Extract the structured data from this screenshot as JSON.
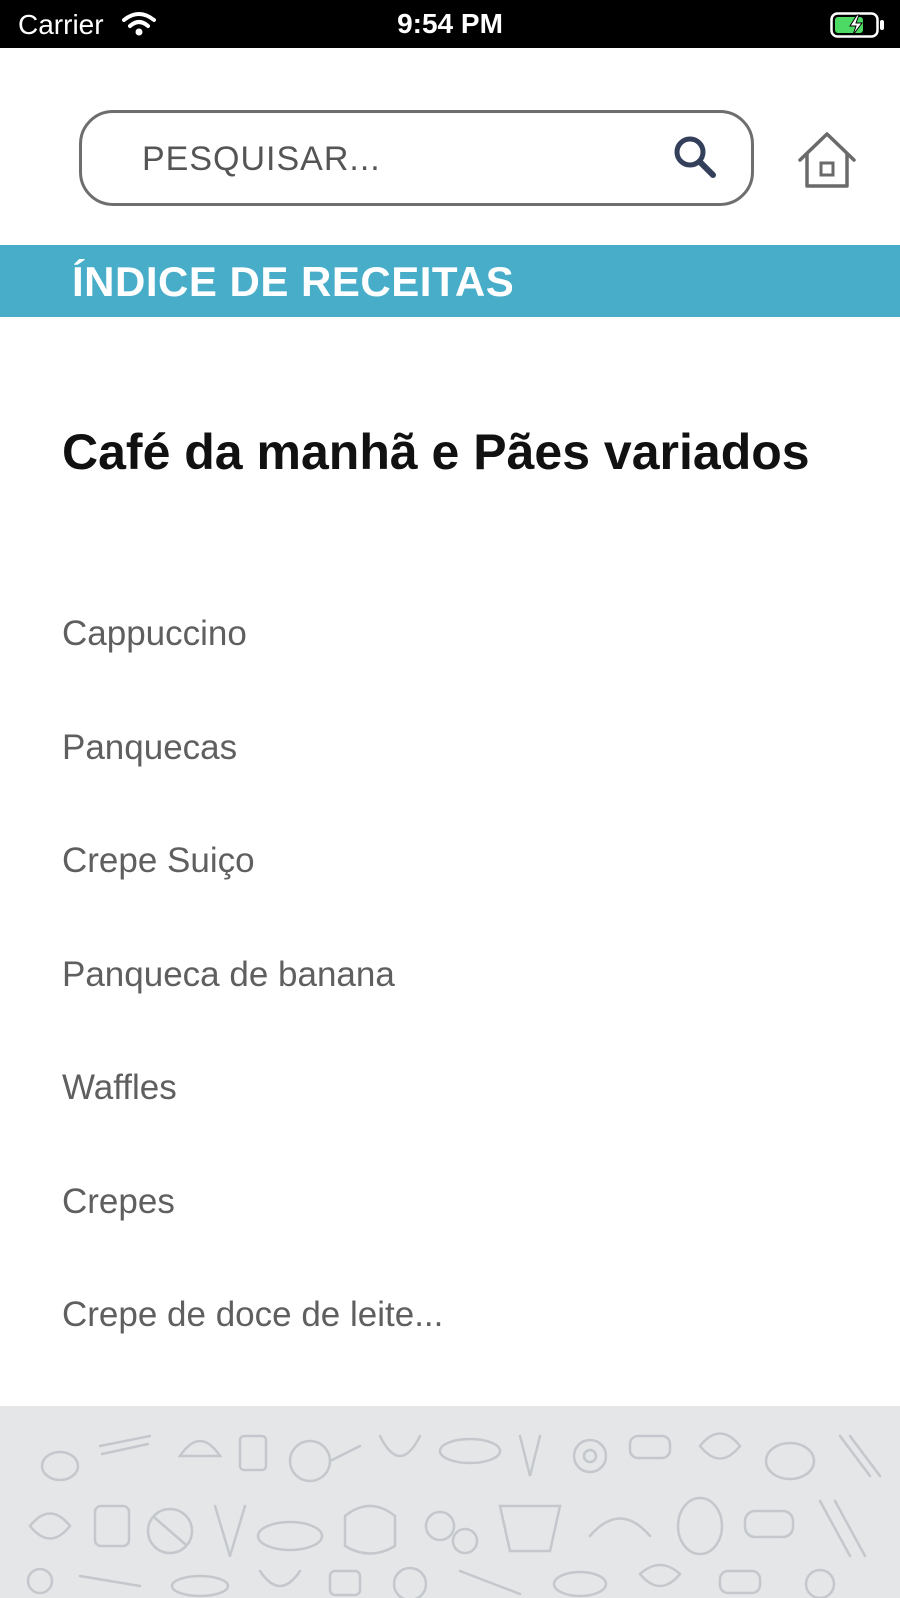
{
  "status_bar": {
    "carrier": "Carrier",
    "time": "9:54 PM",
    "wifi_icon": "wifi-icon",
    "battery_icon": "battery-charging-icon"
  },
  "search": {
    "placeholder": "PESQUISAR...",
    "value": "",
    "icon": "search-icon"
  },
  "header": {
    "home_icon": "home-icon",
    "banner_title": "ÍNDICE DE RECEITAS",
    "banner_color": "#47adc9"
  },
  "section": {
    "title": "Café da manhã e Pães variados",
    "items": [
      {
        "label": "Cappuccino"
      },
      {
        "label": "Panquecas"
      },
      {
        "label": "Crepe Suiço"
      },
      {
        "label": "Panqueca de banana"
      },
      {
        "label": "Waffles"
      },
      {
        "label": "Crepes"
      },
      {
        "label": "Crepe de doce de leite..."
      }
    ]
  },
  "footer": {
    "pattern": "kitchen-doodle-pattern"
  }
}
